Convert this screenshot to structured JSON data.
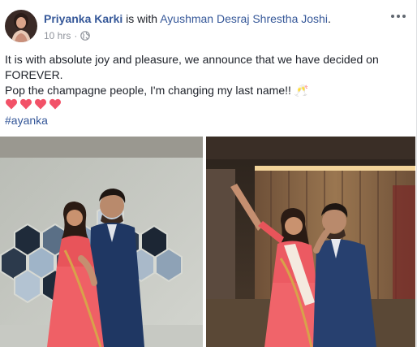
{
  "post": {
    "author": "Priyanka Karki",
    "with_text": " is with ",
    "tagged": "Ayushman Desraj Shrestha Joshi",
    "tagged_suffix": ".",
    "time": "10 hrs",
    "separator": "·",
    "privacy_icon": "globe-icon",
    "more_icon": "more-options-icon",
    "line1": "It is with absolute joy and pleasure, we announce that we have decided on FOREVER.",
    "line2": "Pop the champagne people, I'm changing my last name!! 🥂",
    "hearts": [
      "heart-icon",
      "heart-icon",
      "heart-icon",
      "heart-icon"
    ],
    "hashtag": "#ayanka"
  },
  "photos": [
    {
      "name": "engagement-photo-hexagon-wall"
    },
    {
      "name": "engagement-photo-celebration"
    }
  ],
  "colors": {
    "link": "#365899",
    "text": "#1d2129",
    "meta": "#90949c",
    "heart": "#f25268"
  }
}
